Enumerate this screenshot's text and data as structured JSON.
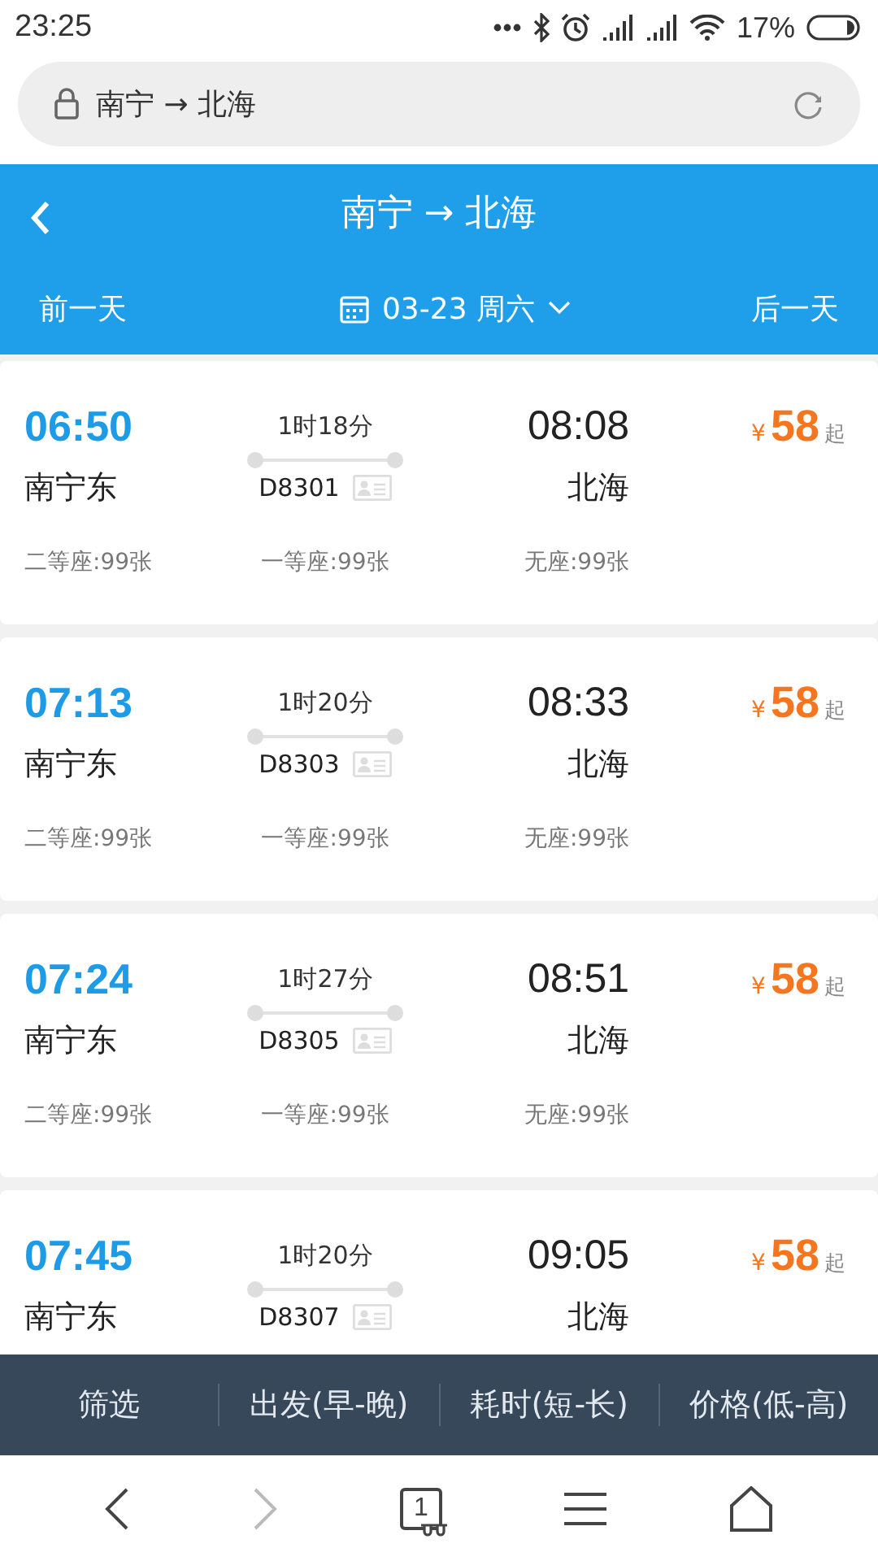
{
  "status_bar": {
    "time": "23:25",
    "battery": "17%"
  },
  "address_bar": {
    "url": "南宁 → 北海"
  },
  "header": {
    "title": "南宁 → 北海",
    "prev_day": "前一天",
    "date": "03-23 周六",
    "next_day": "后一天"
  },
  "trains": [
    {
      "depart_time": "06:50",
      "duration": "1时18分",
      "arrive_time": "08:08",
      "currency": "¥",
      "price": "58",
      "price_suffix": "起",
      "from": "南宁东",
      "train_no": "D8301",
      "to": "北海",
      "seats": [
        "二等座:99张",
        "一等座:99张",
        "无座:99张"
      ]
    },
    {
      "depart_time": "07:13",
      "duration": "1时20分",
      "arrive_time": "08:33",
      "currency": "¥",
      "price": "58",
      "price_suffix": "起",
      "from": "南宁东",
      "train_no": "D8303",
      "to": "北海",
      "seats": [
        "二等座:99张",
        "一等座:99张",
        "无座:99张"
      ]
    },
    {
      "depart_time": "07:24",
      "duration": "1时27分",
      "arrive_time": "08:51",
      "currency": "¥",
      "price": "58",
      "price_suffix": "起",
      "from": "南宁东",
      "train_no": "D8305",
      "to": "北海",
      "seats": [
        "二等座:99张",
        "一等座:99张",
        "无座:99张"
      ]
    },
    {
      "depart_time": "07:45",
      "duration": "1时20分",
      "arrive_time": "09:05",
      "currency": "¥",
      "price": "58",
      "price_suffix": "起",
      "from": "南宁东",
      "train_no": "D8307",
      "to": "北海"
    }
  ],
  "sort_bar": [
    "筛选",
    "出发(早-晚)",
    "耗时(短-长)",
    "价格(低-高)"
  ],
  "nav_buttons": [
    {
      "kind": "back",
      "disabled": false
    },
    {
      "kind": "forward",
      "disabled": true
    },
    {
      "kind": "tabs",
      "count": "1",
      "disabled": false
    },
    {
      "kind": "menu",
      "disabled": false
    },
    {
      "kind": "home",
      "disabled": false
    }
  ]
}
